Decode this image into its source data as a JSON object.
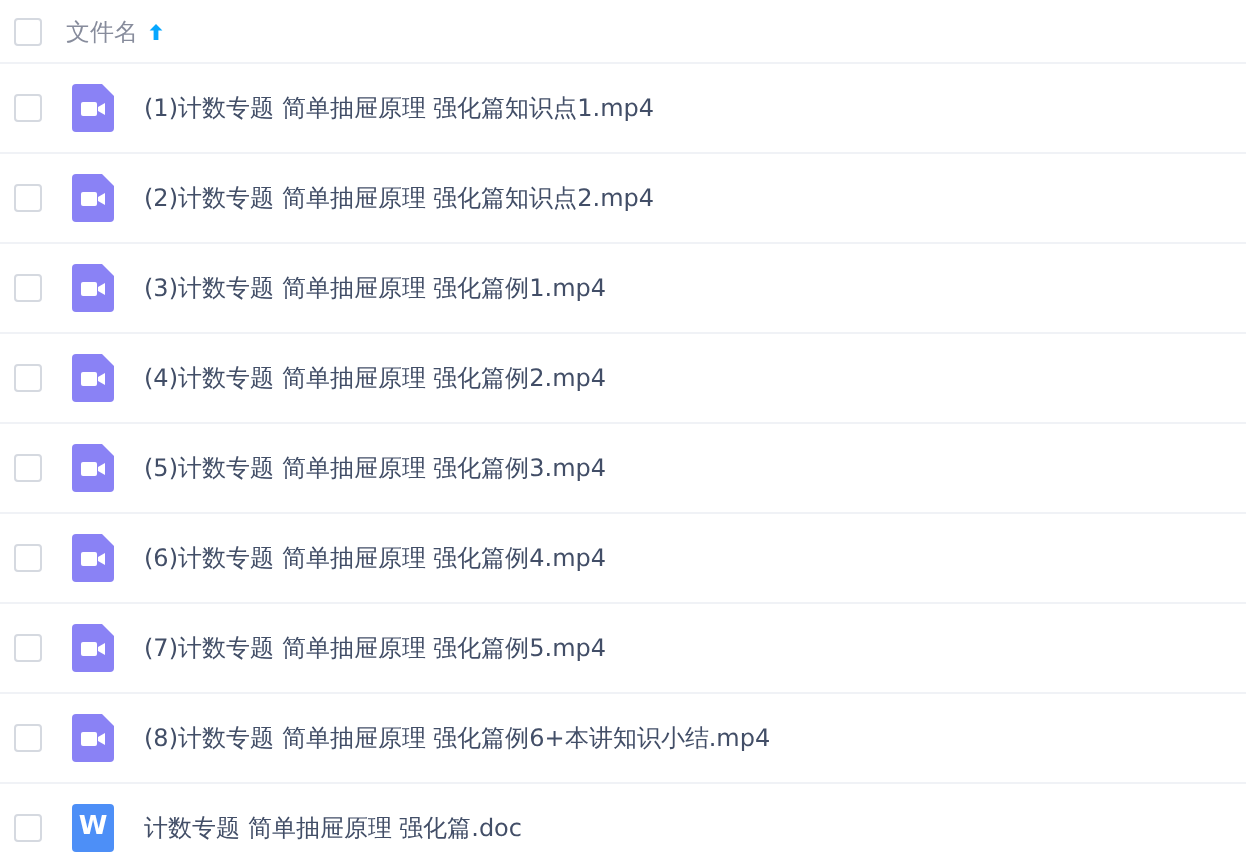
{
  "header": {
    "checked": false,
    "column": "文件名",
    "sort_ascending": true
  },
  "files": [
    {
      "name": "(1)计数专题 简单抽屉原理 强化篇知识点1.mp4",
      "kind": "video",
      "checked": false
    },
    {
      "name": "(2)计数专题 简单抽屉原理 强化篇知识点2.mp4",
      "kind": "video",
      "checked": false
    },
    {
      "name": "(3)计数专题 简单抽屉原理 强化篇例1.mp4",
      "kind": "video",
      "checked": false
    },
    {
      "name": "(4)计数专题 简单抽屉原理 强化篇例2.mp4",
      "kind": "video",
      "checked": false
    },
    {
      "name": "(5)计数专题 简单抽屉原理 强化篇例3.mp4",
      "kind": "video",
      "checked": false
    },
    {
      "name": "(6)计数专题 简单抽屉原理 强化篇例4.mp4",
      "kind": "video",
      "checked": false
    },
    {
      "name": "(7)计数专题 简单抽屉原理 强化篇例5.mp4",
      "kind": "video",
      "checked": false
    },
    {
      "name": "(8)计数专题 简单抽屉原理 强化篇例6+本讲知识小结.mp4",
      "kind": "video",
      "checked": false
    },
    {
      "name": "计数专题 简单抽屉原理 强化篇.doc",
      "kind": "doc",
      "icon_text": "W",
      "checked": false
    }
  ]
}
